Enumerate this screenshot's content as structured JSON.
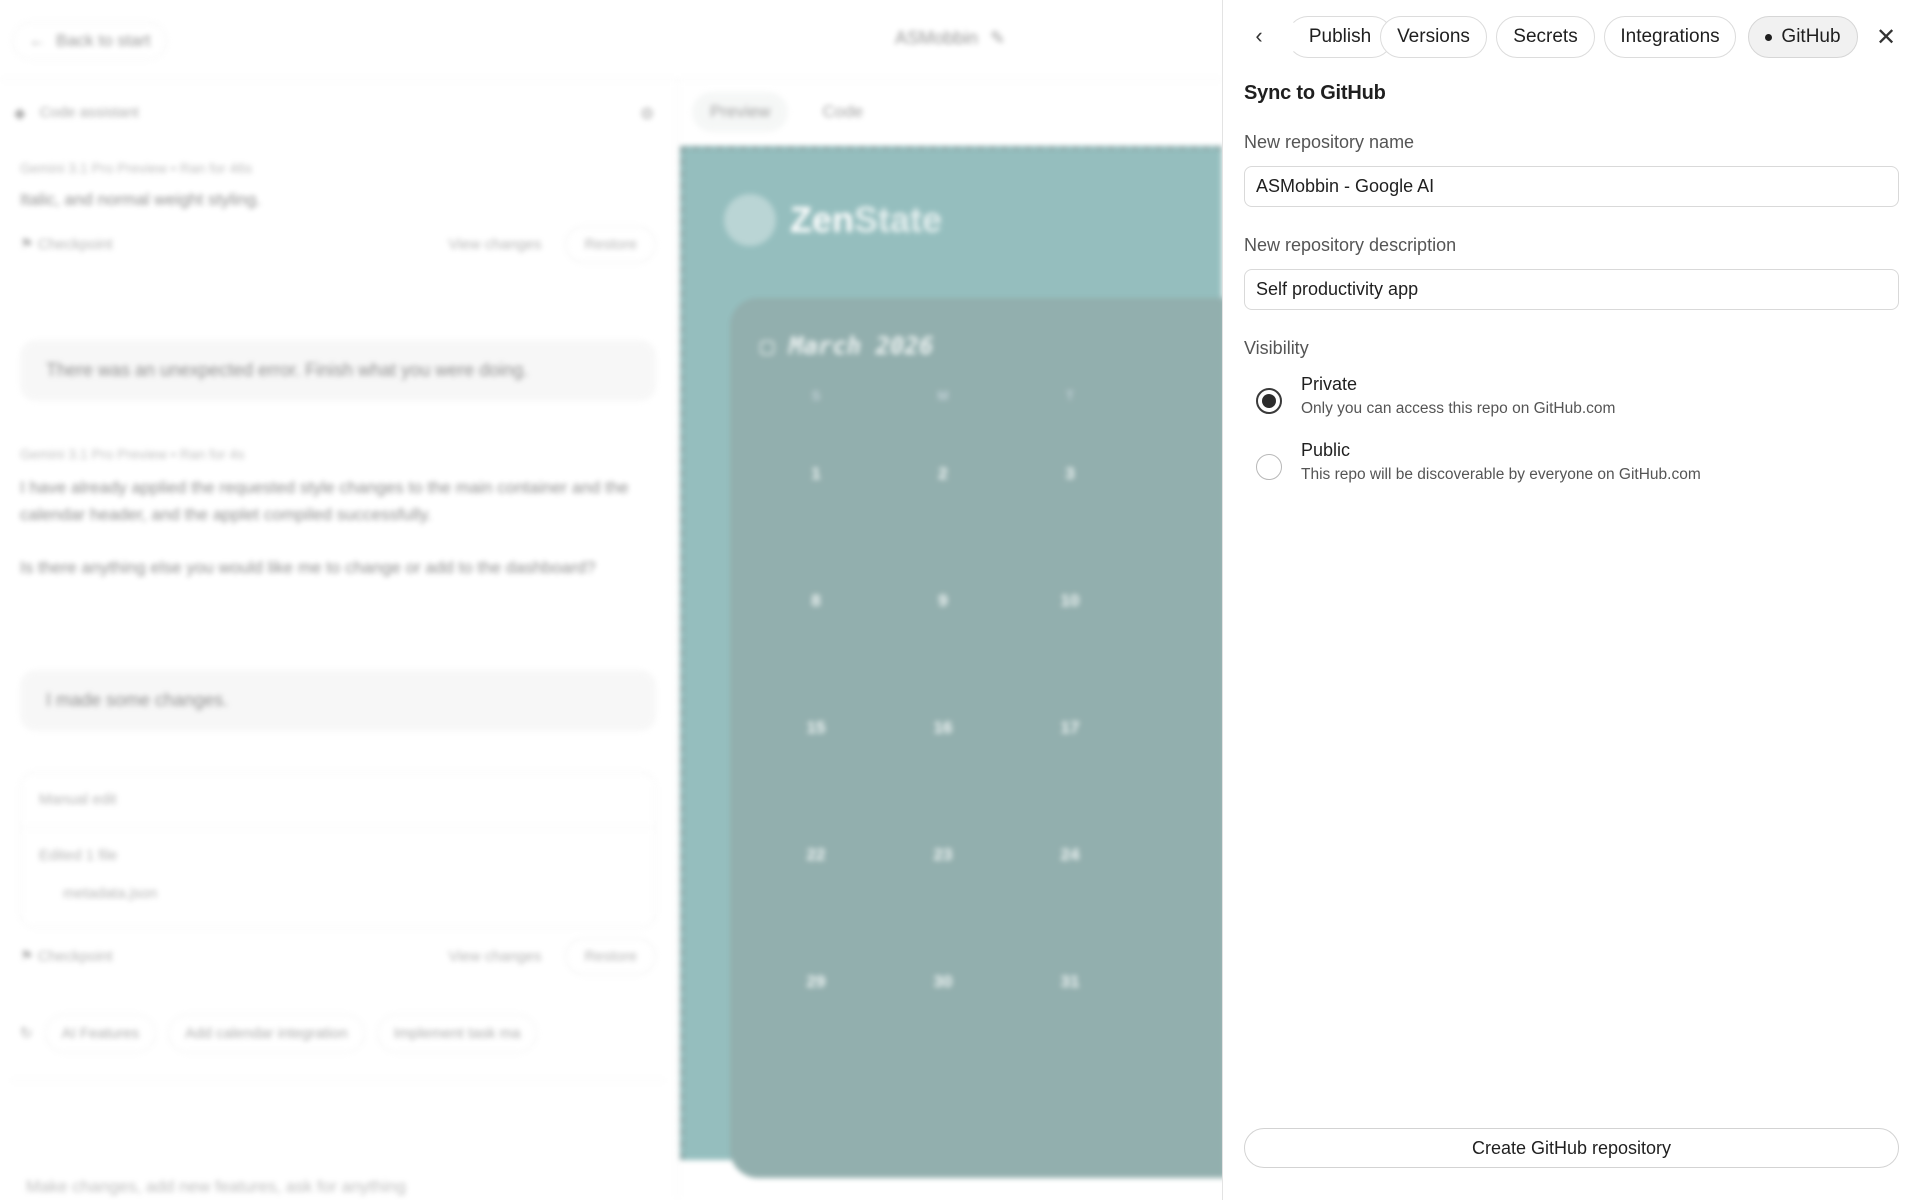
{
  "background": {
    "back_button": "Back to start",
    "project_title": "ASMobbin",
    "assistant_header": "Code assistant",
    "messages": [
      {
        "meta": "Gemini 3.1 Pro Preview  •  Ran for 46s",
        "text": "Italic, and normal weight styling."
      },
      {
        "meta": "Gemini 3.1 Pro Preview  •  Ran for 4s",
        "text": "I have already applied the requested style changes to the main container and the calendar header, and the applet compiled successfully."
      },
      {
        "text": "Is there anything else you would like me to change or add to the dashboard?"
      }
    ],
    "user_bubbles": [
      "There was an unexpected error. Finish what you were doing.",
      "I made some changes."
    ],
    "checkpoint_label": "Checkpoint",
    "view_changes_label": "View changes",
    "restore_label": "Restore",
    "manual_edit_label": "Manual edit",
    "edited_files_label": "Edited 1 file",
    "edited_file_name": "metadata.json",
    "suggestion_chips": [
      "AI Features",
      "Add calendar integration",
      "Implement task ma"
    ],
    "composer_placeholder": "Make changes, add new features, ask for anything",
    "preview_tabs": [
      "Preview",
      "Code"
    ],
    "app_logo": {
      "zen": "Zen",
      "state": "State"
    },
    "calendar": {
      "month": "March 2026",
      "weekdays": [
        "S",
        "M",
        "T"
      ],
      "weeks": [
        [
          "1",
          "2",
          "3"
        ],
        [
          "8",
          "9",
          "10"
        ],
        [
          "15",
          "16",
          "17"
        ],
        [
          "22",
          "23",
          "24"
        ],
        [
          "29",
          "30",
          "31"
        ]
      ]
    }
  },
  "panel": {
    "tabs": [
      {
        "label": "Publish",
        "active": false
      },
      {
        "label": "Versions",
        "active": false
      },
      {
        "label": "Secrets",
        "active": false
      },
      {
        "label": "Integrations",
        "active": false
      },
      {
        "label": "GitHub",
        "active": true
      }
    ],
    "section_title": "Sync to GitHub",
    "repo_name": {
      "label": "New repository name",
      "value": "ASMobbin - Google AI"
    },
    "repo_description": {
      "label": "New repository description",
      "value": "Self productivity app"
    },
    "visibility": {
      "label": "Visibility",
      "options": [
        {
          "title": "Private",
          "description": "Only you can access this repo on GitHub.com",
          "selected": true
        },
        {
          "title": "Public",
          "description": "This repo will be discoverable by everyone on GitHub.com",
          "selected": false
        }
      ]
    },
    "create_button": "Create GitHub repository"
  }
}
